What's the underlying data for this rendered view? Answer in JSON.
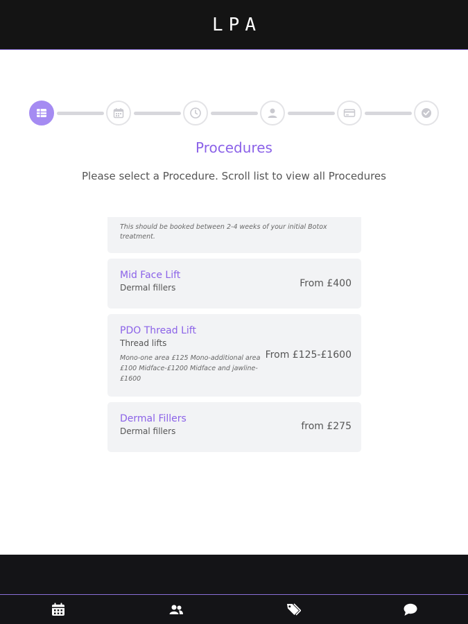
{
  "app": {
    "title": "LPA"
  },
  "stepper": {
    "steps": [
      {
        "icon": "list-icon",
        "active": true
      },
      {
        "icon": "calendar-icon",
        "active": false
      },
      {
        "icon": "clock-icon",
        "active": false
      },
      {
        "icon": "user-icon",
        "active": false
      },
      {
        "icon": "credit-card-icon",
        "active": false
      },
      {
        "icon": "check-circle-icon",
        "active": false
      }
    ]
  },
  "page": {
    "heading": "Procedures",
    "subtitle": "Please select a Procedure. Scroll list to view all Procedures"
  },
  "procedures": {
    "partial_note": "This should be booked between 2-4 weeks of your initial Botox treatment.",
    "items": [
      {
        "name": "Mid Face Lift",
        "category": "Dermal fillers",
        "note": "",
        "price": "From £400"
      },
      {
        "name": "PDO Thread Lift",
        "category": "Thread lifts",
        "note": "Mono-one area £125 Mono-additional area £100 Midface-£1200 Midface and jawline-£1600",
        "price": "From £125-£1600"
      },
      {
        "name": "Dermal Fillers",
        "category": "Dermal fillers",
        "note": "",
        "price": "from £275"
      }
    ]
  },
  "bottom_nav": {
    "items": [
      {
        "icon": "calendar-icon"
      },
      {
        "icon": "users-icon"
      },
      {
        "icon": "tags-icon"
      },
      {
        "icon": "chat-icon"
      }
    ]
  },
  "colors": {
    "accent": "#8b62e8",
    "accent_light": "#a58bf2",
    "bar_bg": "#141414",
    "card_bg": "#f2f3f5"
  }
}
